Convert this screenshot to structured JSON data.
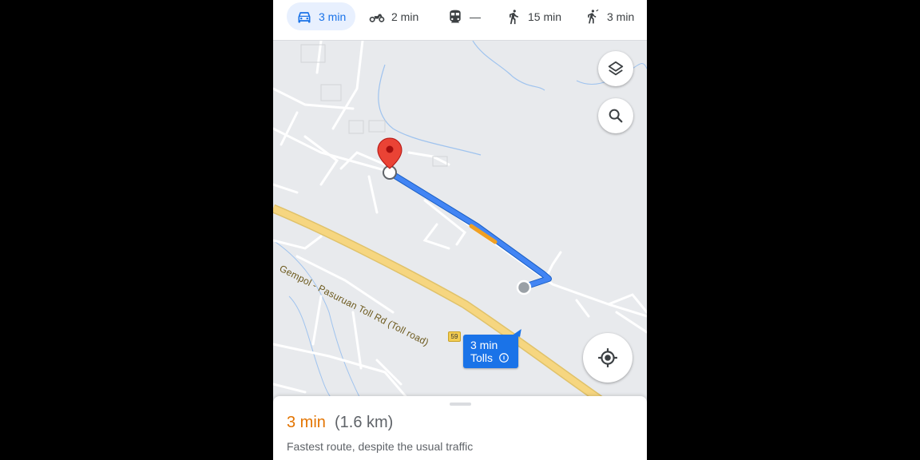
{
  "modes": [
    {
      "icon": "car-icon",
      "label": "3 min",
      "active": true
    },
    {
      "icon": "motorcycle-icon",
      "label": "2 min"
    },
    {
      "icon": "transit-icon",
      "label": "—"
    },
    {
      "icon": "walking-icon",
      "label": "15 min"
    },
    {
      "icon": "ride-hailing-icon",
      "label": "3 min"
    }
  ],
  "map": {
    "road_name": "Gempol - Pasuruan Toll Rd (Toll road)",
    "road_shield": "59",
    "route_label": {
      "time": "3 min",
      "tolls": "Tolls"
    },
    "controls": [
      "layers-icon",
      "search-icon",
      "my-location-icon"
    ],
    "colors": {
      "route": "#4285f4",
      "traffic": "#f0a022",
      "pin": "#ea4335",
      "toll_road": "#f6d680"
    }
  },
  "sheet": {
    "time": "3 min",
    "distance": "(1.6 km)",
    "description": "Fastest route, despite the usual traffic"
  }
}
